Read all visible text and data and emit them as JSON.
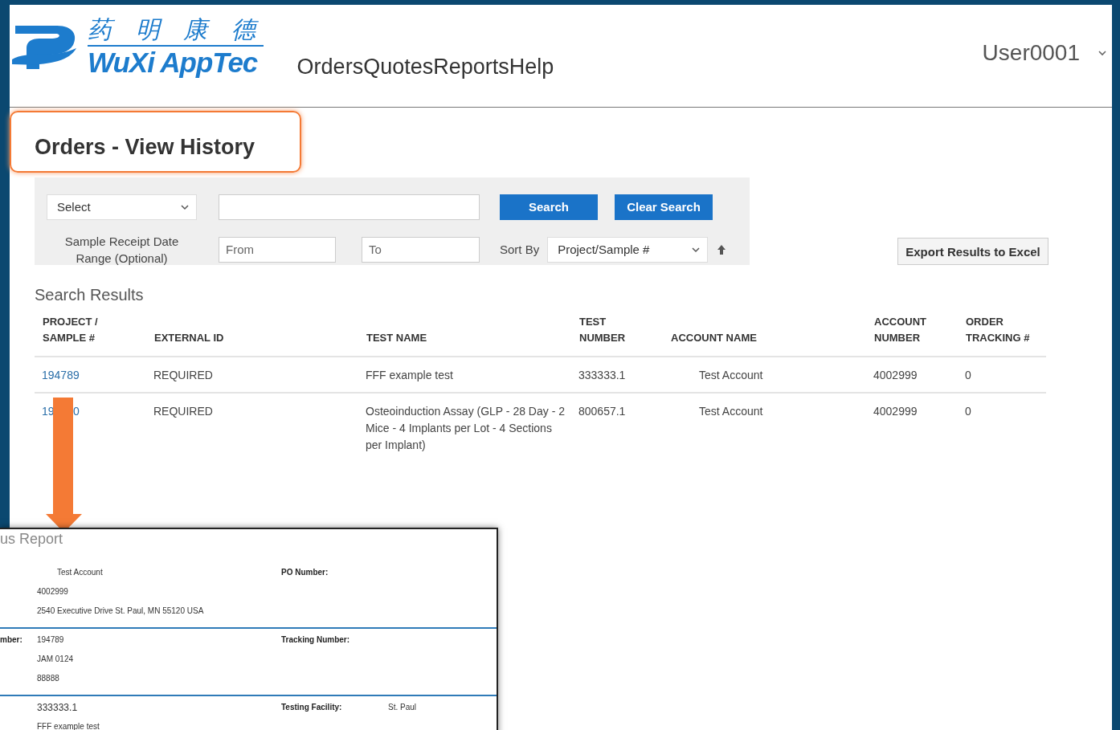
{
  "header": {
    "logo_chinese": "药 明 康 德",
    "logo_text": "WuXi AppTec",
    "nav": [
      "Orders",
      "Quotes",
      "Reports",
      "Help"
    ],
    "user": "User0001"
  },
  "page_title": "Orders - View History",
  "search": {
    "field_select": "Select",
    "search_button": "Search",
    "clear_button": "Clear Search",
    "date_range_label": "Sample Receipt Date\nRange (Optional)",
    "from_placeholder": "From",
    "to_placeholder": "To",
    "sort_label": "Sort By",
    "sort_value": "Project/Sample #"
  },
  "export_button": "Export Results to Excel",
  "results": {
    "title": "Search Results",
    "columns": [
      "PROJECT /\nSAMPLE #",
      "EXTERNAL ID",
      "TEST NAME",
      "TEST\nNUMBER",
      "ACCOUNT NAME",
      "ACCOUNT\nNUMBER",
      "ORDER\nTRACKING #"
    ],
    "rows": [
      {
        "sample": "194789",
        "external_id": "REQUIRED",
        "test_name": "FFF example test",
        "test_number": "333333.1",
        "account_name": "Test Account",
        "account_number": "4002999",
        "tracking": "0"
      },
      {
        "sample": "19      0",
        "external_id": "REQUIRED",
        "test_name": "Osteoinduction Assay (GLP - 28 Day - 2 Mice - 4 Implants per Lot - 4 Sections per Implant)",
        "test_number": "800657.1",
        "account_name": "Test Account",
        "account_number": "4002999",
        "tracking": "0"
      }
    ]
  },
  "report": {
    "title": "us Report",
    "sections": [
      {
        "values": [
          "Test Account",
          "4002999",
          "2540 Executive Drive St. Paul, MN 55120 USA"
        ],
        "right_label": "PO Number:"
      },
      {
        "label": "mber:",
        "values": [
          "194789",
          "JAM 0124",
          "88888"
        ],
        "right_label": "Tracking Number:"
      },
      {
        "values": [
          "333333.1",
          "FFF example test"
        ],
        "right_label": "Testing Facility:",
        "right_value": "St. Paul"
      }
    ]
  }
}
